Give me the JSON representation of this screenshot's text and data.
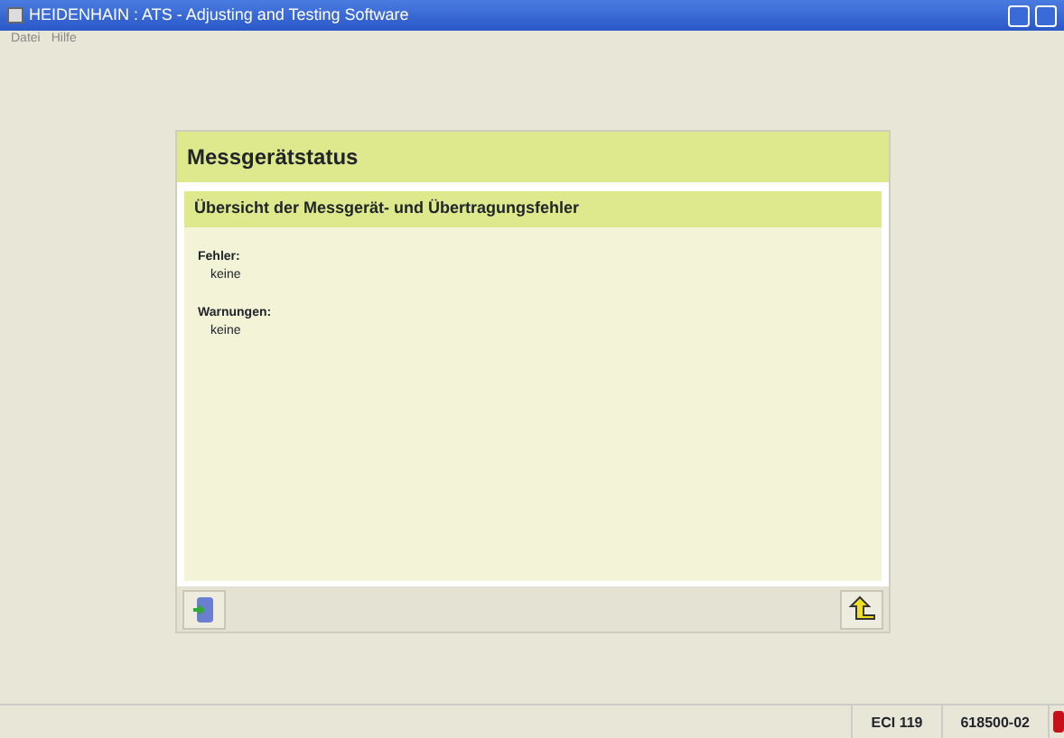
{
  "window": {
    "title": "HEIDENHAIN : ATS - Adjusting and Testing Software"
  },
  "menu": [
    "Datei",
    "Hilfe"
  ],
  "panel": {
    "title": "Messgerätstatus",
    "subtitle": "Übersicht der Messgerät- und Übertragungsfehler",
    "sections": [
      {
        "label": "Fehler:",
        "value": "keine"
      },
      {
        "label": "Warnungen:",
        "value": "keine"
      }
    ]
  },
  "status_bar": {
    "fields": [
      "ECI 119",
      "618500-02"
    ]
  }
}
